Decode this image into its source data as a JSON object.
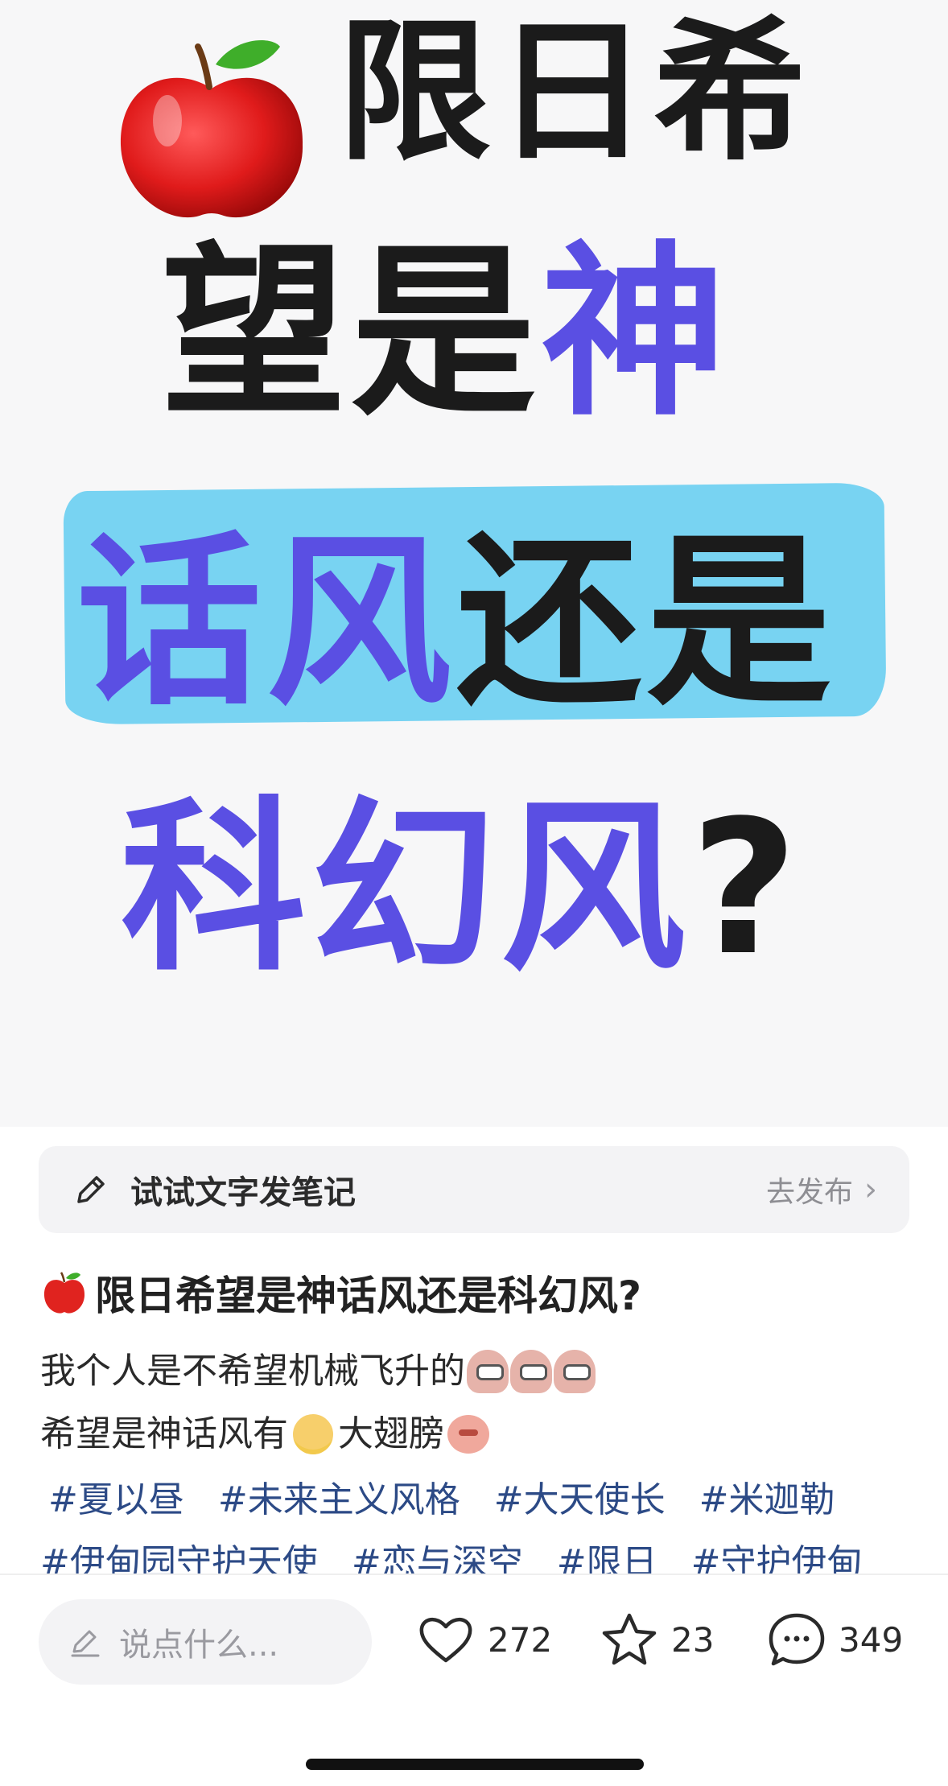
{
  "hero": {
    "line1": "限日希",
    "line2_black": "望是",
    "line2_purple": "神",
    "line3_purple": "话风",
    "line3_black": "还是",
    "line4_purple": "科幻风",
    "line4_black": "?"
  },
  "prompt_bar": {
    "text": "试试文字发笔记",
    "action": "去发布",
    "chevron": "›"
  },
  "post": {
    "title": "限日希望是神话风还是科幻风?",
    "body_line1": "我个人是不希望机械飞升的",
    "body_line2_a": "希望是神话风有",
    "body_line2_b": "大翅膀",
    "tags_row1": [
      "#夏以昼",
      "#未来主义风格",
      "#大天使长",
      "#米迦勒"
    ],
    "tags_row2": [
      "#伊甸园守护天使",
      "#恋与深空",
      "#限日",
      "#守护伊甸"
    ]
  },
  "bottom_bar": {
    "comment_placeholder": "说点什么...",
    "likes": "272",
    "favorites": "23",
    "comments": "349"
  },
  "colors": {
    "accent_purple": "#5a4fe3",
    "brush_blue": "#78d3f2",
    "tag_blue": "#2c4a86"
  }
}
